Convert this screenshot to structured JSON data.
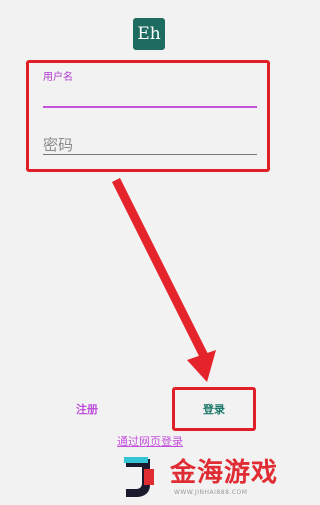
{
  "app": {
    "icon_text": "Eh",
    "icon_color": "#1e6b60"
  },
  "form": {
    "username_label": "用户名",
    "username_value": "",
    "password_placeholder": "密码"
  },
  "actions": {
    "register_label": "注册",
    "login_label": "登录",
    "web_login_label": "通过网页登录"
  },
  "watermark": {
    "brand_text": "金海游戏",
    "brand_sub": "WWW.JINHAI888.COM"
  },
  "colors": {
    "highlight_red": "#e21f26",
    "accent_purple": "#c452dc",
    "primary_teal": "#1d7a6b"
  }
}
